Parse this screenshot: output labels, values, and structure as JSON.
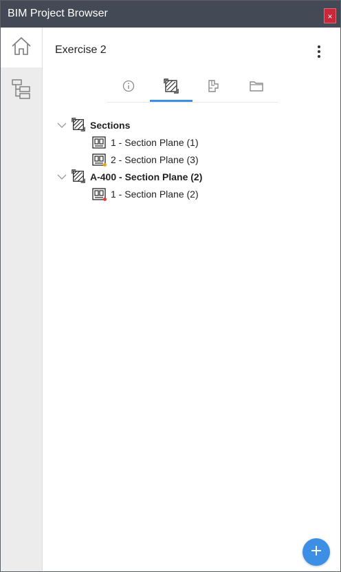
{
  "window": {
    "title": "BIM Project Browser",
    "close_glyph": "×",
    "close_color": "#c8283a",
    "titlebar_color": "#434a55"
  },
  "sidebar": {
    "items": [
      {
        "icon": "home-icon",
        "active": true
      },
      {
        "icon": "tree-structure-icon",
        "active": false
      }
    ]
  },
  "header": {
    "title": "Exercise 2",
    "menu_icon": "more-vertical-icon"
  },
  "tabs": [
    {
      "icon": "info-icon",
      "active": false
    },
    {
      "icon": "section-icon",
      "active": true
    },
    {
      "icon": "floor-plan-icon",
      "active": false
    },
    {
      "icon": "folder-icon",
      "active": false
    }
  ],
  "tree": {
    "groups": [
      {
        "label": "Sections",
        "icon": "section-icon",
        "expanded": true,
        "children": [
          {
            "label": "1 - Section Plane (1)",
            "icon": "section-plane-icon",
            "status": "none"
          },
          {
            "label": "2 - Section Plane (3)",
            "icon": "section-plane-icon",
            "status": "#e8a21a"
          }
        ]
      },
      {
        "label": "A-400 - Section Plane (2)",
        "icon": "section-icon",
        "expanded": true,
        "children": [
          {
            "label": "1 - Section Plane (2)",
            "icon": "section-plane-icon",
            "status": "#e23b3b"
          }
        ]
      }
    ]
  },
  "fab": {
    "glyph": "+",
    "icon": "add-icon",
    "color": "#3d8fe6"
  }
}
